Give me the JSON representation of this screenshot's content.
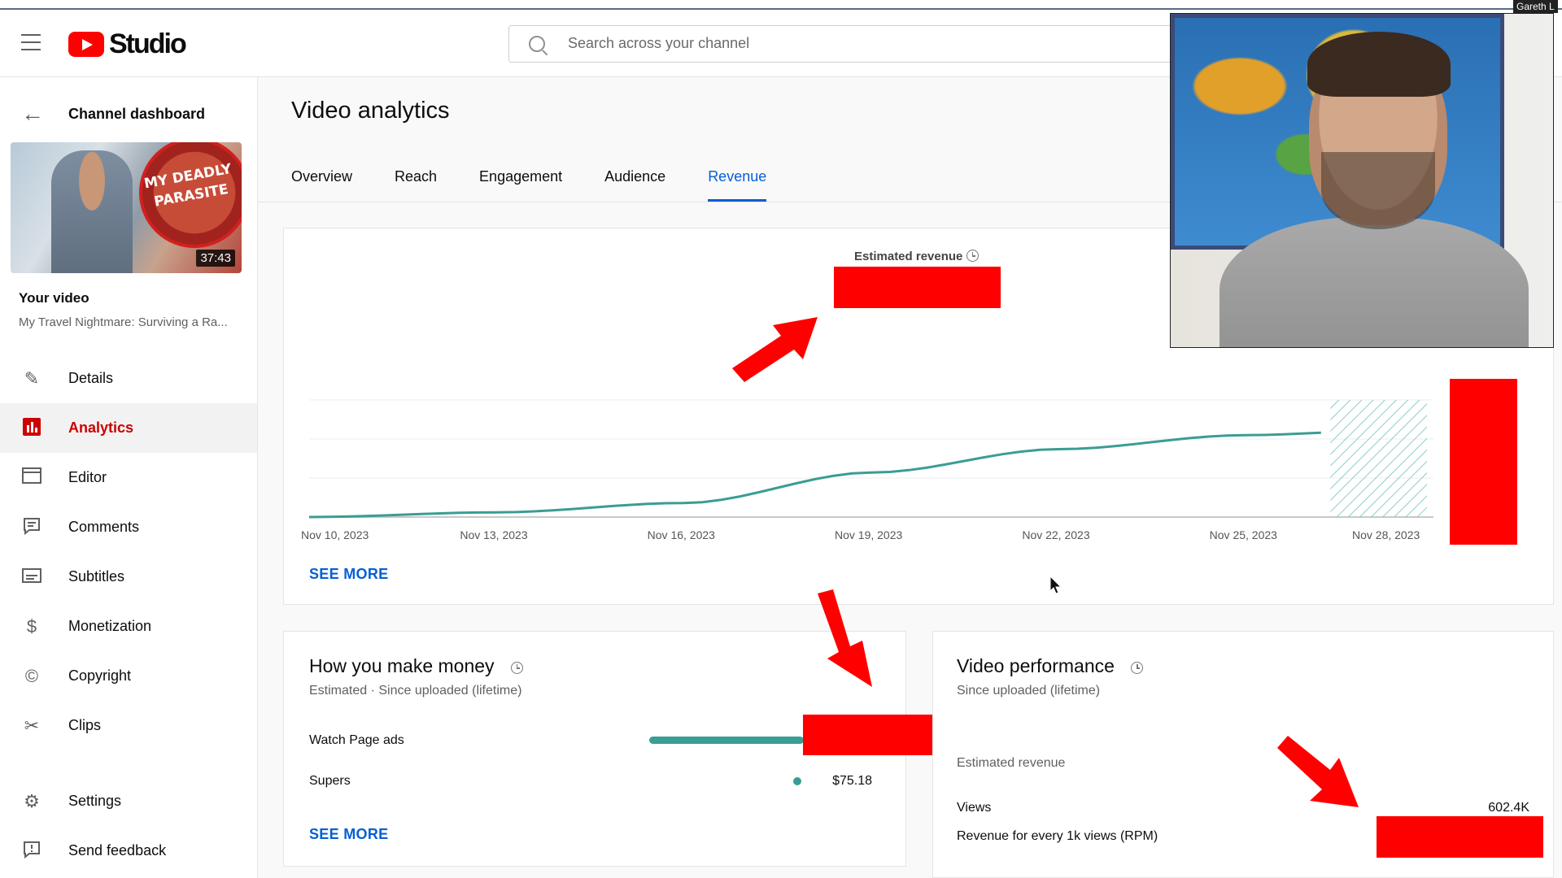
{
  "app": {
    "name": "Studio"
  },
  "search": {
    "placeholder": "Search across your channel"
  },
  "sidebar": {
    "back_label": "Channel dashboard",
    "thumbnail": {
      "text": "MY DEADLY PARASITE",
      "duration": "37:43"
    },
    "your_video_label": "Your video",
    "video_title": "My Travel Nightmare: Surviving a Ra...",
    "items": [
      {
        "label": "Details",
        "icon": "pencil-icon"
      },
      {
        "label": "Analytics",
        "icon": "analytics-icon",
        "active": true
      },
      {
        "label": "Editor",
        "icon": "film-icon"
      },
      {
        "label": "Comments",
        "icon": "comments-icon"
      },
      {
        "label": "Subtitles",
        "icon": "subtitles-icon"
      },
      {
        "label": "Monetization",
        "icon": "dollar-icon"
      },
      {
        "label": "Copyright",
        "icon": "copyright-icon"
      },
      {
        "label": "Clips",
        "icon": "scissors-icon"
      }
    ],
    "bottom_items": [
      {
        "label": "Settings",
        "icon": "gear-icon"
      },
      {
        "label": "Send feedback",
        "icon": "feedback-icon"
      }
    ]
  },
  "main": {
    "title": "Video analytics",
    "tabs": [
      "Overview",
      "Reach",
      "Engagement",
      "Audience",
      "Revenue"
    ],
    "active_tab": "Revenue"
  },
  "chart_data": {
    "type": "line",
    "title": "Estimated revenue",
    "x": [
      "Nov 10, 2023",
      "Nov 13, 2023",
      "Nov 16, 2023",
      "Nov 19, 2023",
      "Nov 22, 2023",
      "Nov 25, 2023",
      "Nov 28, 2023"
    ],
    "series": [
      {
        "values": [
          0,
          0.04,
          0.12,
          0.38,
          0.58,
          0.7,
          0.76
        ]
      }
    ],
    "forecast_region": {
      "from": "Nov 25, 2023",
      "to": "Nov 28, 2023",
      "style": "hatched"
    },
    "grid": true,
    "color": "#3a9d93",
    "note": "values are relative; y-axis and totals redacted"
  },
  "chart_card": {
    "see_more": "SEE MORE"
  },
  "money": {
    "title": "How you make money",
    "subtitle": "Estimated · Since uploaded (lifetime)",
    "rows": [
      {
        "label": "Watch Page ads",
        "share": 1.0
      },
      {
        "label": "Supers",
        "value": "$75.18",
        "share": 0.0
      }
    ],
    "see_more": "SEE MORE"
  },
  "performance": {
    "title": "Video performance",
    "subtitle": "Since uploaded (lifetime)",
    "rows": [
      {
        "label": "Estimated revenue",
        "value": ""
      },
      {
        "label": "Views",
        "value": "602.4K"
      },
      {
        "label": "Revenue for every 1k views (RPM)",
        "value": ""
      }
    ]
  },
  "overlay": {
    "webcam_tag": "Gareth L"
  },
  "colors": {
    "accent": "#065fd4",
    "active": "#cc0000",
    "series": "#3a9d93",
    "redaction": "#ff0000"
  }
}
